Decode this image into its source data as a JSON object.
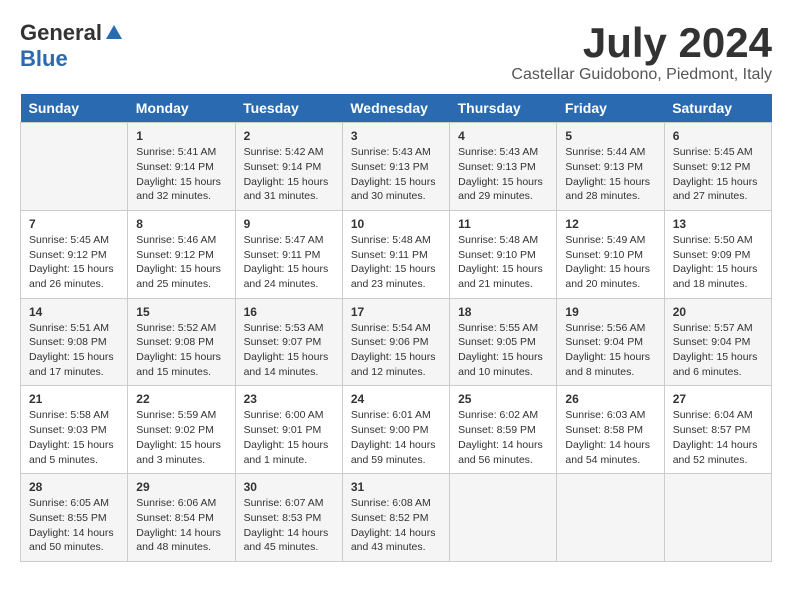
{
  "header": {
    "logo_general": "General",
    "logo_blue": "Blue",
    "month_year": "July 2024",
    "location": "Castellar Guidobono, Piedmont, Italy"
  },
  "days_of_week": [
    "Sunday",
    "Monday",
    "Tuesday",
    "Wednesday",
    "Thursday",
    "Friday",
    "Saturday"
  ],
  "weeks": [
    [
      {
        "day": "",
        "content": ""
      },
      {
        "day": "1",
        "content": "Sunrise: 5:41 AM\nSunset: 9:14 PM\nDaylight: 15 hours\nand 32 minutes."
      },
      {
        "day": "2",
        "content": "Sunrise: 5:42 AM\nSunset: 9:14 PM\nDaylight: 15 hours\nand 31 minutes."
      },
      {
        "day": "3",
        "content": "Sunrise: 5:43 AM\nSunset: 9:13 PM\nDaylight: 15 hours\nand 30 minutes."
      },
      {
        "day": "4",
        "content": "Sunrise: 5:43 AM\nSunset: 9:13 PM\nDaylight: 15 hours\nand 29 minutes."
      },
      {
        "day": "5",
        "content": "Sunrise: 5:44 AM\nSunset: 9:13 PM\nDaylight: 15 hours\nand 28 minutes."
      },
      {
        "day": "6",
        "content": "Sunrise: 5:45 AM\nSunset: 9:12 PM\nDaylight: 15 hours\nand 27 minutes."
      }
    ],
    [
      {
        "day": "7",
        "content": "Sunrise: 5:45 AM\nSunset: 9:12 PM\nDaylight: 15 hours\nand 26 minutes."
      },
      {
        "day": "8",
        "content": "Sunrise: 5:46 AM\nSunset: 9:12 PM\nDaylight: 15 hours\nand 25 minutes."
      },
      {
        "day": "9",
        "content": "Sunrise: 5:47 AM\nSunset: 9:11 PM\nDaylight: 15 hours\nand 24 minutes."
      },
      {
        "day": "10",
        "content": "Sunrise: 5:48 AM\nSunset: 9:11 PM\nDaylight: 15 hours\nand 23 minutes."
      },
      {
        "day": "11",
        "content": "Sunrise: 5:48 AM\nSunset: 9:10 PM\nDaylight: 15 hours\nand 21 minutes."
      },
      {
        "day": "12",
        "content": "Sunrise: 5:49 AM\nSunset: 9:10 PM\nDaylight: 15 hours\nand 20 minutes."
      },
      {
        "day": "13",
        "content": "Sunrise: 5:50 AM\nSunset: 9:09 PM\nDaylight: 15 hours\nand 18 minutes."
      }
    ],
    [
      {
        "day": "14",
        "content": "Sunrise: 5:51 AM\nSunset: 9:08 PM\nDaylight: 15 hours\nand 17 minutes."
      },
      {
        "day": "15",
        "content": "Sunrise: 5:52 AM\nSunset: 9:08 PM\nDaylight: 15 hours\nand 15 minutes."
      },
      {
        "day": "16",
        "content": "Sunrise: 5:53 AM\nSunset: 9:07 PM\nDaylight: 15 hours\nand 14 minutes."
      },
      {
        "day": "17",
        "content": "Sunrise: 5:54 AM\nSunset: 9:06 PM\nDaylight: 15 hours\nand 12 minutes."
      },
      {
        "day": "18",
        "content": "Sunrise: 5:55 AM\nSunset: 9:05 PM\nDaylight: 15 hours\nand 10 minutes."
      },
      {
        "day": "19",
        "content": "Sunrise: 5:56 AM\nSunset: 9:04 PM\nDaylight: 15 hours\nand 8 minutes."
      },
      {
        "day": "20",
        "content": "Sunrise: 5:57 AM\nSunset: 9:04 PM\nDaylight: 15 hours\nand 6 minutes."
      }
    ],
    [
      {
        "day": "21",
        "content": "Sunrise: 5:58 AM\nSunset: 9:03 PM\nDaylight: 15 hours\nand 5 minutes."
      },
      {
        "day": "22",
        "content": "Sunrise: 5:59 AM\nSunset: 9:02 PM\nDaylight: 15 hours\nand 3 minutes."
      },
      {
        "day": "23",
        "content": "Sunrise: 6:00 AM\nSunset: 9:01 PM\nDaylight: 15 hours\nand 1 minute."
      },
      {
        "day": "24",
        "content": "Sunrise: 6:01 AM\nSunset: 9:00 PM\nDaylight: 14 hours\nand 59 minutes."
      },
      {
        "day": "25",
        "content": "Sunrise: 6:02 AM\nSunset: 8:59 PM\nDaylight: 14 hours\nand 56 minutes."
      },
      {
        "day": "26",
        "content": "Sunrise: 6:03 AM\nSunset: 8:58 PM\nDaylight: 14 hours\nand 54 minutes."
      },
      {
        "day": "27",
        "content": "Sunrise: 6:04 AM\nSunset: 8:57 PM\nDaylight: 14 hours\nand 52 minutes."
      }
    ],
    [
      {
        "day": "28",
        "content": "Sunrise: 6:05 AM\nSunset: 8:55 PM\nDaylight: 14 hours\nand 50 minutes."
      },
      {
        "day": "29",
        "content": "Sunrise: 6:06 AM\nSunset: 8:54 PM\nDaylight: 14 hours\nand 48 minutes."
      },
      {
        "day": "30",
        "content": "Sunrise: 6:07 AM\nSunset: 8:53 PM\nDaylight: 14 hours\nand 45 minutes."
      },
      {
        "day": "31",
        "content": "Sunrise: 6:08 AM\nSunset: 8:52 PM\nDaylight: 14 hours\nand 43 minutes."
      },
      {
        "day": "",
        "content": ""
      },
      {
        "day": "",
        "content": ""
      },
      {
        "day": "",
        "content": ""
      }
    ]
  ]
}
